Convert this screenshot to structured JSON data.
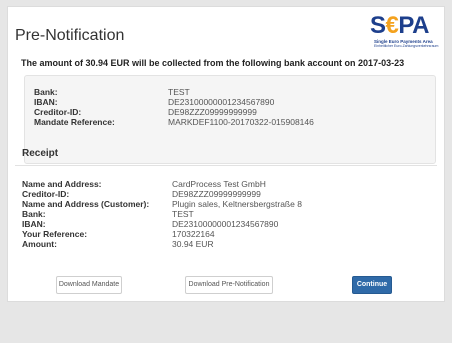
{
  "page": {
    "title": "Pre-Notification",
    "intro_prefix": "The amount of ",
    "intro_amount": "30.94 EUR",
    "intro_suffix": " will be collected from the following bank account on 2017-03-23"
  },
  "logo": {
    "text_start": "S",
    "text_euro": "€",
    "text_end": "PA",
    "line1": "Single Euro Payments Area",
    "line2": "Einheitlicher Euro-Zahlungsverkehrsraum"
  },
  "bank_details": [
    {
      "label": "Bank:",
      "value": "TEST"
    },
    {
      "label": "IBAN:",
      "value": "DE23100000001234567890"
    },
    {
      "label": "Creditor-ID:",
      "value": "DE98ZZZ09999999999"
    },
    {
      "label": "Mandate Reference:",
      "value": "MARKDEF1100-20170322-015908146"
    }
  ],
  "receipt": {
    "title": "Receipt",
    "rows": [
      {
        "label": "Name and Address:",
        "value": "CardProcess Test GmbH"
      },
      {
        "label": "Creditor-ID:",
        "value": "DE98ZZZ09999999999"
      },
      {
        "label": "Name and Address (Customer):",
        "value": "Plugin sales, Keltnersbergstraße 8"
      },
      {
        "label": "Bank:",
        "value": "TEST"
      },
      {
        "label": "IBAN:",
        "value": "DE23100000001234567890"
      },
      {
        "label": "Your Reference:",
        "value": "170322164"
      },
      {
        "label": "Amount:",
        "value": "30.94 EUR"
      }
    ]
  },
  "buttons": {
    "download_mandate": "Download Mandate",
    "download_prenotification": "Download Pre-Notification",
    "continue": "Continue"
  },
  "colors": {
    "background": "#e6e6e6",
    "primary_button": "#2f6aa8",
    "logo_blue": "#1d3f8c",
    "logo_gold": "#f4a21e"
  }
}
